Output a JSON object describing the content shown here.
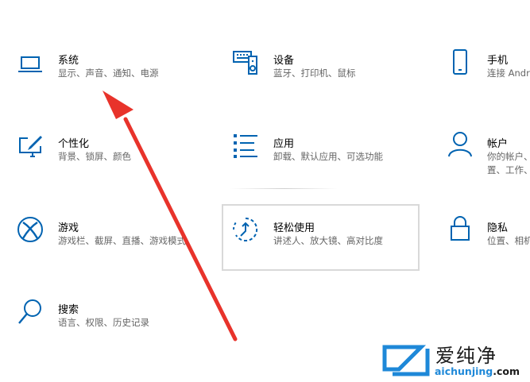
{
  "colors": {
    "accent": "#0063b1",
    "arrow": "#e8332b",
    "desc": "#666666"
  },
  "tiles": [
    {
      "id": "system",
      "title": "系统",
      "desc": "显示、声音、通知、电源",
      "icon": "laptop-icon"
    },
    {
      "id": "devices",
      "title": "设备",
      "desc": "蓝牙、打印机、鼠标",
      "icon": "keyboard-speaker-icon"
    },
    {
      "id": "phone",
      "title": "手机",
      "desc": "连接 Andr",
      "icon": "phone-icon"
    },
    {
      "id": "personalization",
      "title": "个性化",
      "desc": "背景、锁屏、颜色",
      "icon": "paint-monitor-icon"
    },
    {
      "id": "apps",
      "title": "应用",
      "desc": "卸载、默认应用、可选功能",
      "icon": "apps-list-icon"
    },
    {
      "id": "accounts",
      "title": "帐户",
      "desc_lines": [
        "你的帐户、",
        "置、工作、"
      ],
      "icon": "person-icon"
    },
    {
      "id": "gaming",
      "title": "游戏",
      "desc": "游戏栏、截屏、直播、游戏模式",
      "icon": "xbox-icon"
    },
    {
      "id": "ease",
      "title": "轻松使用",
      "desc": "讲述人、放大镜、高对比度",
      "icon": "ease-of-access-icon"
    },
    {
      "id": "privacy",
      "title": "隐私",
      "desc": "位置、相机",
      "icon": "lock-icon"
    },
    {
      "id": "search",
      "title": "搜索",
      "desc": "语言、权限、历史记录",
      "icon": "search-icon"
    }
  ],
  "watermark": {
    "cn": "爱纯净",
    "en_a": "aichunjing",
    "en_b": ".com"
  }
}
